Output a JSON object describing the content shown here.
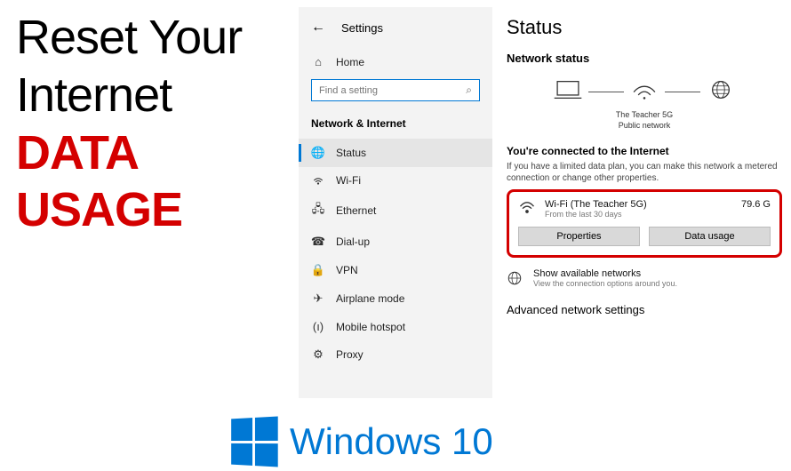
{
  "title": {
    "l1": "Reset Your",
    "l2": "Internet",
    "l3": "DATA",
    "l4": "USAGE"
  },
  "settings": {
    "header": "Settings",
    "home": "Home",
    "search_placeholder": "Find a setting",
    "section": "Network & Internet",
    "items": [
      {
        "label": "Status"
      },
      {
        "label": "Wi-Fi"
      },
      {
        "label": "Ethernet"
      },
      {
        "label": "Dial-up"
      },
      {
        "label": "VPN"
      },
      {
        "label": "Airplane mode"
      },
      {
        "label": "Mobile hotspot"
      },
      {
        "label": "Proxy"
      }
    ]
  },
  "status": {
    "title": "Status",
    "subtitle": "Network status",
    "diagram": {
      "name": "The Teacher 5G",
      "type": "Public network"
    },
    "connected_title": "You're connected to the Internet",
    "connected_desc": "If you have a limited data plan, you can make this network a metered connection or change other properties.",
    "conn": {
      "name": "Wi-Fi (The Teacher 5G)",
      "sub": "From the last 30 days",
      "amount": "79.6 G"
    },
    "btn_properties": "Properties",
    "btn_data_usage": "Data usage",
    "show_networks": {
      "title": "Show available networks",
      "sub": "View the connection options around you."
    },
    "advanced": "Advanced network settings"
  },
  "logo": "Windows 10"
}
